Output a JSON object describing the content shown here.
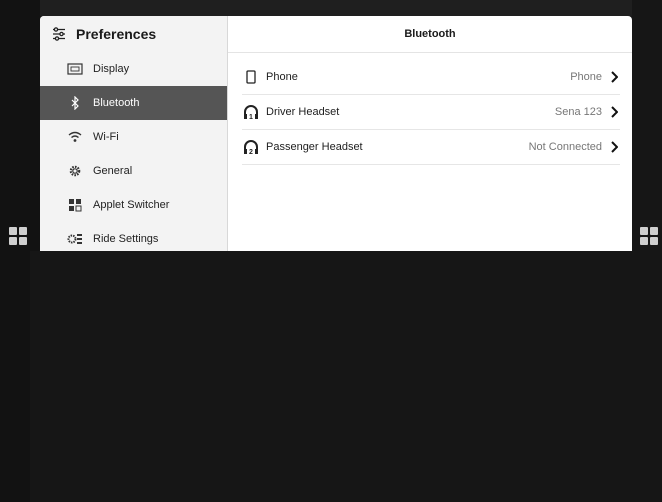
{
  "sidebar": {
    "title": "Preferences",
    "items": [
      {
        "label": "Display",
        "icon": "display-icon"
      },
      {
        "label": "Bluetooth",
        "icon": "bluetooth-icon",
        "active": true
      },
      {
        "label": "Wi-Fi",
        "icon": "wifi-icon"
      },
      {
        "label": "General",
        "icon": "gear-icon"
      },
      {
        "label": "Applet Switcher",
        "icon": "applet-switcher-icon"
      },
      {
        "label": "Ride Settings",
        "icon": "ride-settings-icon"
      }
    ]
  },
  "main": {
    "title": "Bluetooth",
    "rows": [
      {
        "label": "Phone",
        "value": "Phone",
        "icon": "phone-icon"
      },
      {
        "label": "Driver Headset",
        "value": "Sena 123",
        "icon": "headset-1-icon",
        "badge": "1"
      },
      {
        "label": "Passenger Headset",
        "value": "Not Connected",
        "icon": "headset-2-icon",
        "badge": "2"
      }
    ]
  },
  "colors": {
    "active_background": "#555555",
    "sidebar_background": "#f3f3f3",
    "value_text": "#777777"
  }
}
